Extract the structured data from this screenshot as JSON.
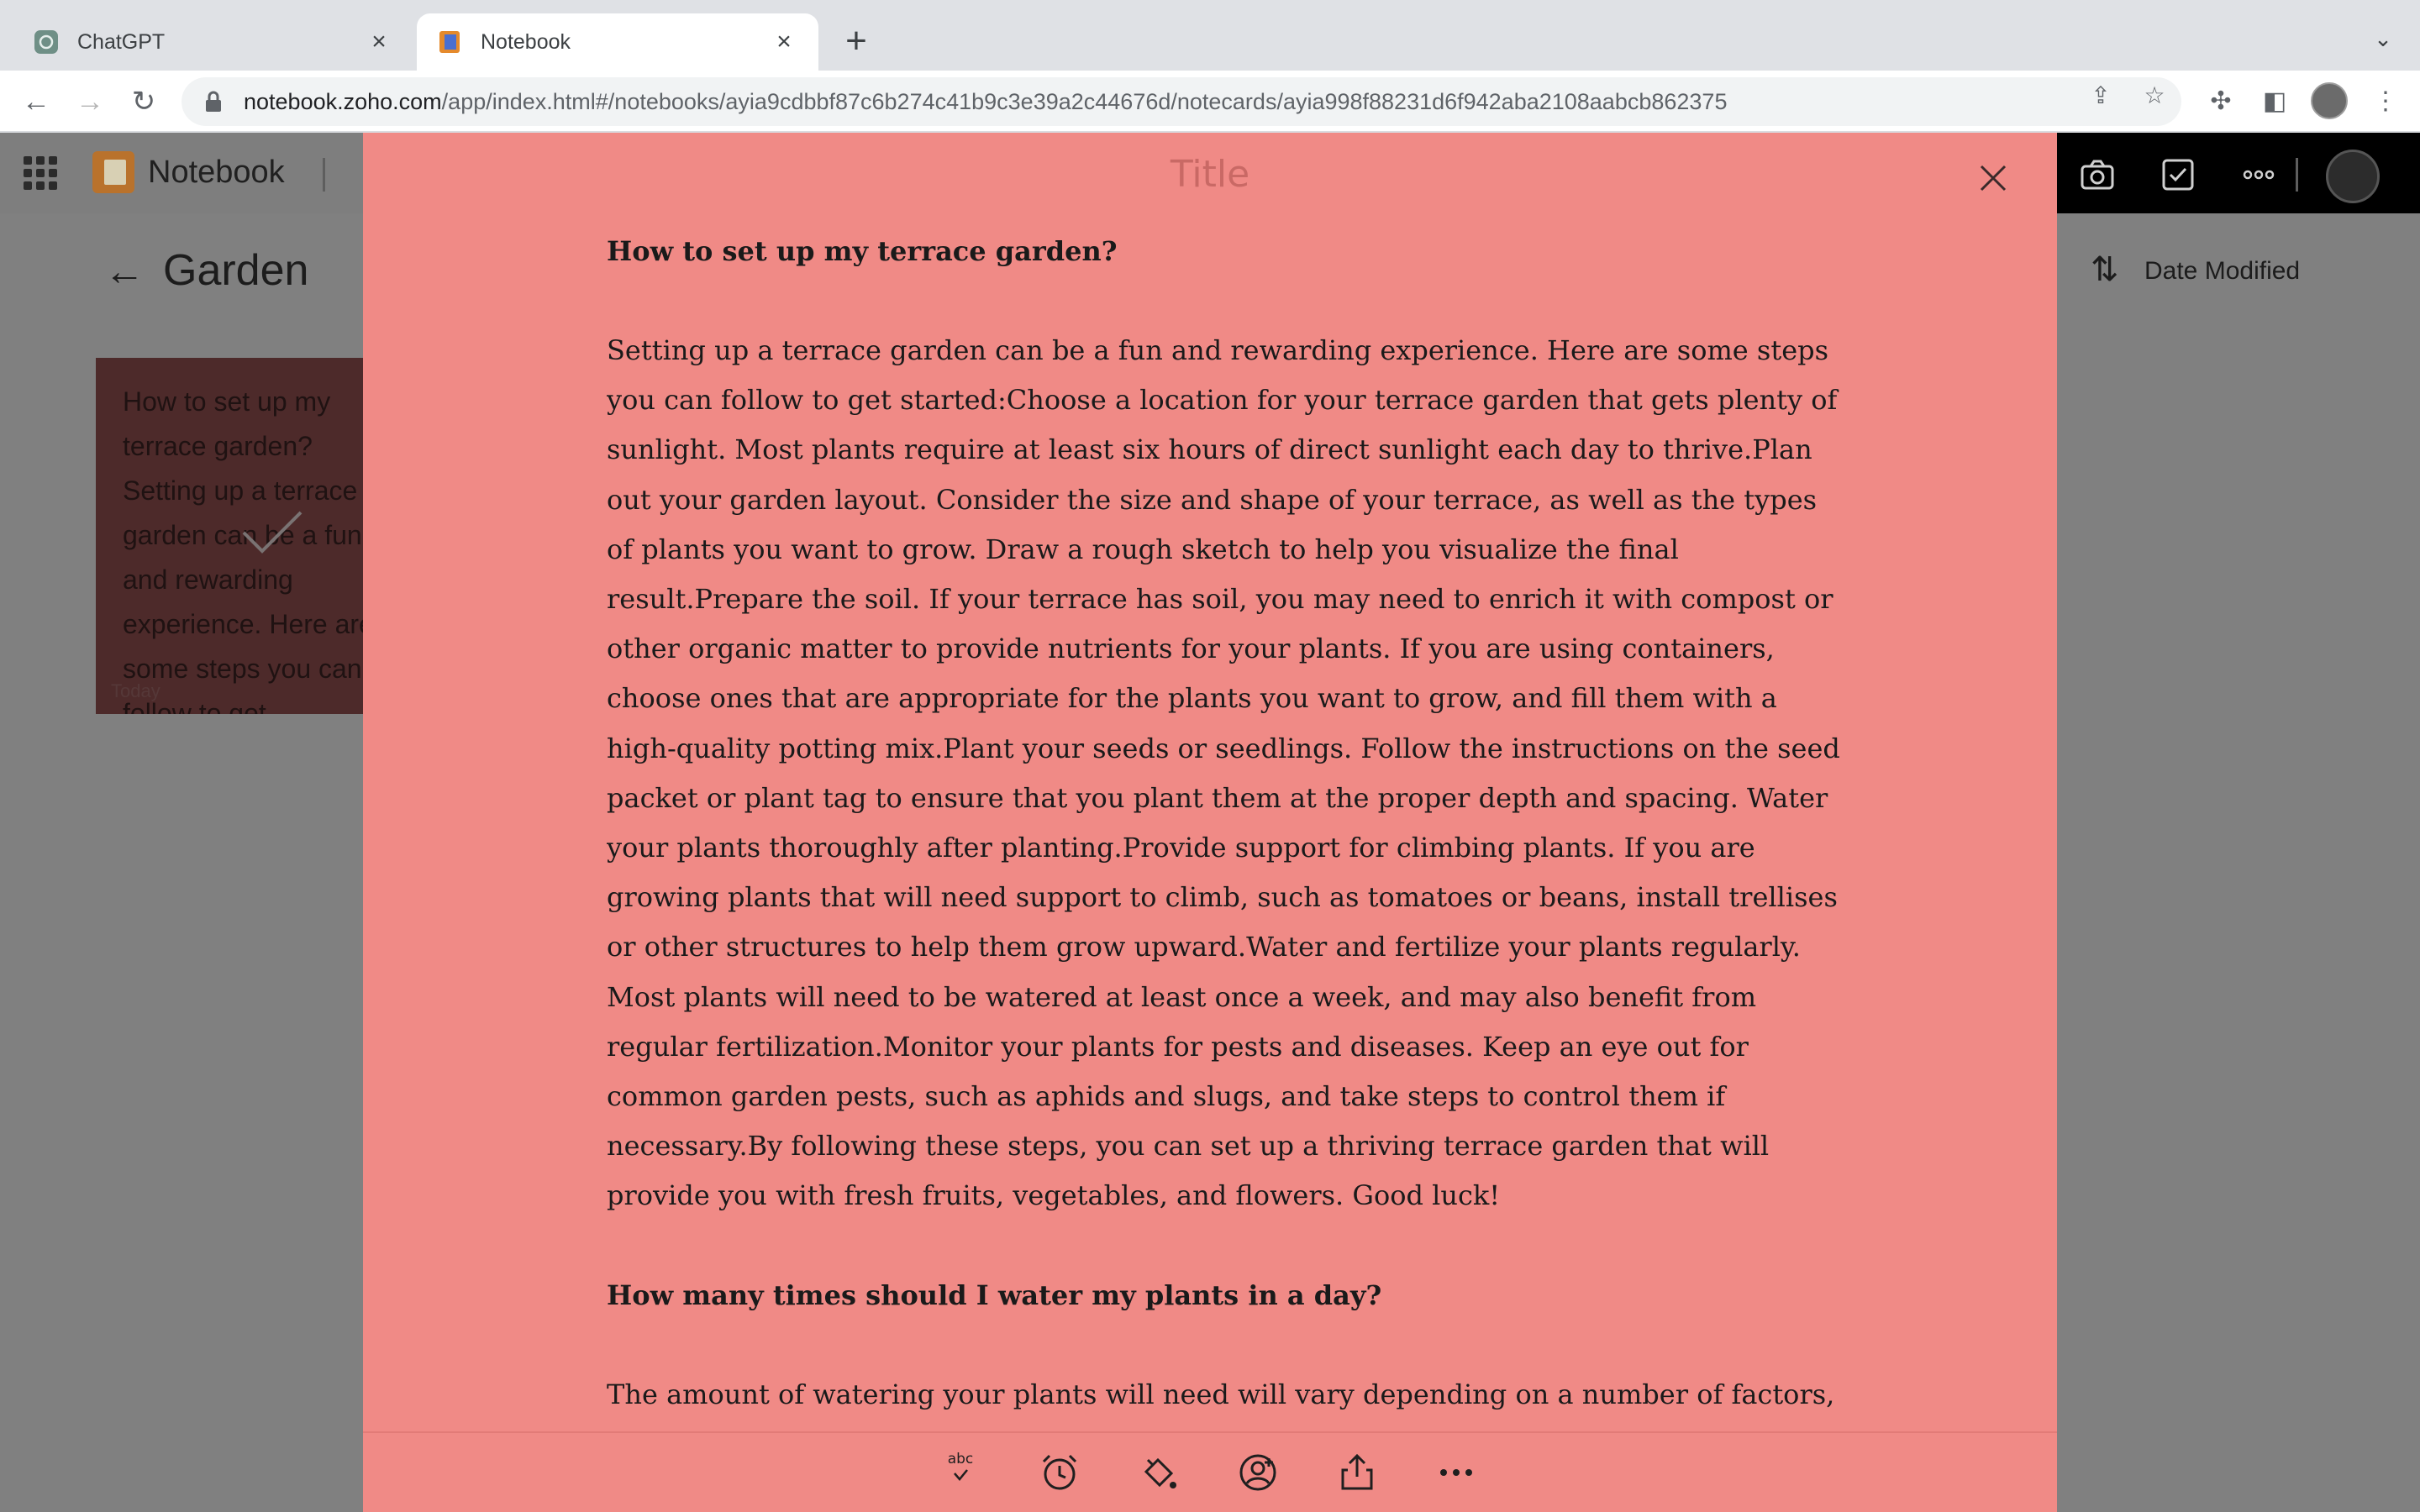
{
  "browser": {
    "tabs": [
      {
        "title": "ChatGPT",
        "icon": "chatgpt-icon"
      },
      {
        "title": "Notebook",
        "icon": "notebook-favicon",
        "active": true
      }
    ],
    "url_host": "notebook.zoho.com",
    "url_path": "/app/index.html#/notebooks/ayia9cdbbf87c6b274c41b9c3e39a2c44676d/notecards/ayia998f88231d6f942aba2108aabcb862375"
  },
  "app": {
    "name": "Notebook",
    "notebook_title": "Garden",
    "sort_fragment": "r",
    "sort_label": "Date Modified"
  },
  "card": {
    "preview": "How to set up my terrace garden? Setting up a terrace garden can be a fun and rewarding experience. Here are some steps you can follow to get",
    "date": "Today"
  },
  "note": {
    "title_placeholder": "Title",
    "question_1": "How to set up my terrace garden?",
    "answer_1": "Setting up a terrace garden can be a fun and rewarding experience. Here are some steps you can follow to get started:Choose a location for your terrace garden that gets plenty of sunlight. Most plants require at least six hours of direct sunlight each day to thrive.Plan out your garden layout. Consider the size and shape of your terrace, as well as the types of plants you want to grow. Draw a rough sketch to help you visualize the final result.Prepare the soil. If your terrace has soil, you may need to enrich it with compost or other organic matter to provide nutrients for your plants. If you are using containers, choose ones that are appropriate for the plants you want to grow, and fill them with a high-quality potting mix.Plant your seeds or seedlings. Follow the instructions on the seed packet or plant tag to ensure that you plant them at the proper depth and spacing. Water your plants thoroughly after planting.Provide support for climbing plants. If you are growing plants that will need support to climb, such as tomatoes or beans, install trellises or other structures to help them grow upward.Water and fertilize your plants regularly. Most plants will need to be watered at least once a week, and may also benefit from regular fertilization.Monitor your plants for pests and diseases. Keep an eye out for common garden pests, such as aphids and slugs, and take steps to control them if necessary.By following these steps, you can set up a thriving terrace garden that will provide you with fresh fruits, vegetables, and flowers. Good luck!",
    "question_2": "How many times should I water my plants in a day?",
    "answer_2": "The amount of watering your plants will need will vary depending on a number of factors, including the type of plants you are growing, the size and type of container they are in, the",
    "background_color": "#f08a86",
    "spellcheck_label": "abc"
  }
}
